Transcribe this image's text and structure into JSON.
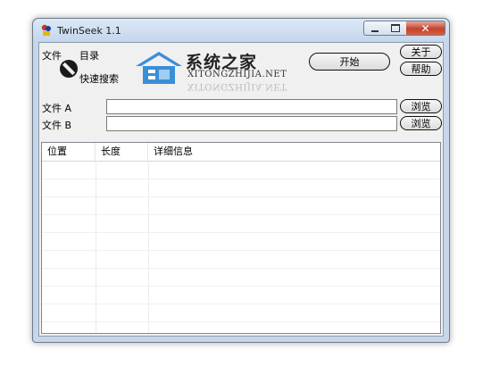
{
  "window": {
    "title": "TwinSeek 1.1"
  },
  "controls": {
    "mode_file_label": "文件",
    "mode_dir_label": "目录",
    "quick_search_label": "快速搜索",
    "start_button": "开始",
    "about_button": "关于",
    "help_button": "帮助"
  },
  "watermark": {
    "title": "系统之家",
    "subtitle": "XITONGZHIJIA.NET"
  },
  "files": {
    "file_a_label": "文件 A",
    "file_a_value": "",
    "file_b_label": "文件 B",
    "file_b_value": "",
    "browse_a": "浏览",
    "browse_b": "浏览"
  },
  "results": {
    "columns": [
      "位置",
      "长度",
      "详细信息"
    ],
    "rows": []
  },
  "colors": {
    "close_button": "#c4432b",
    "frame": "#c7d7eb"
  }
}
